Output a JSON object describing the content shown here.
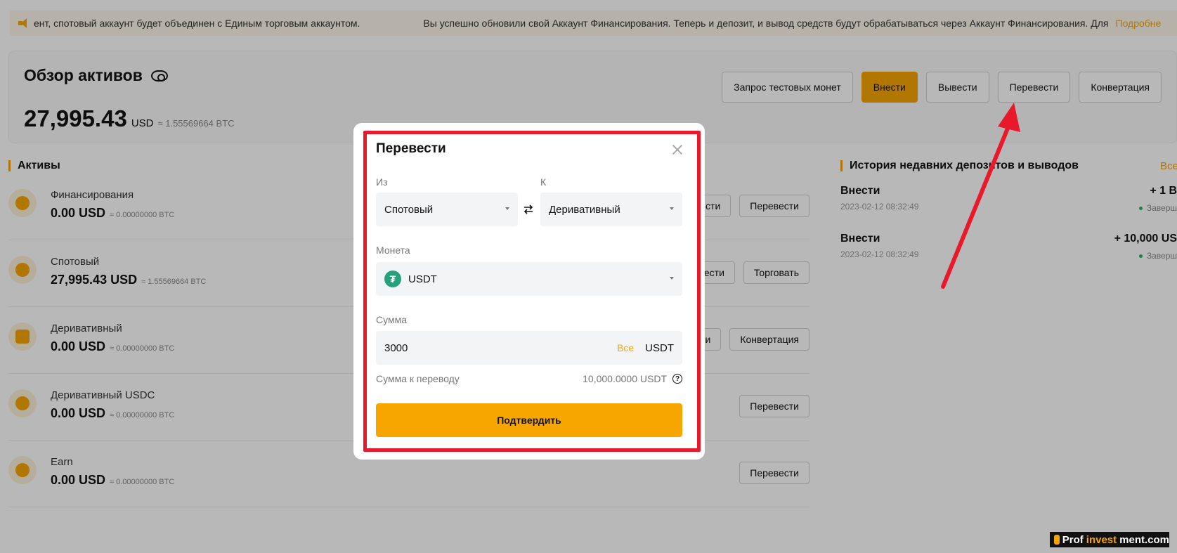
{
  "notice": {
    "text_left": "ент, спотовый аккаунт будет объединен с Единым торговым аккаунтом.",
    "text_main": "Вы успешно обновили свой Аккаунт Финансирования. Теперь и депозит, и вывод средств будут обрабатываться через Аккаунт Финансирования. Для",
    "more": "Подробне"
  },
  "overview": {
    "title": "Обзор активов",
    "amount": "27,995.43",
    "currency": "USD",
    "btc": "≈ 1.55569664 BTC",
    "buttons": {
      "test_coins": "Запрос тестовых монет",
      "deposit": "Внести",
      "withdraw": "Вывести",
      "transfer": "Перевести",
      "convert": "Конвертация"
    }
  },
  "assets": {
    "title": "Активы",
    "rows": [
      {
        "name": "Финансирования",
        "value": "0.00 USD",
        "btc": "≈ 0.00000000 BTC",
        "btn1": "сти",
        "btn2": "Перевести"
      },
      {
        "name": "Спотовый",
        "value": "27,995.43 USD",
        "btc": "≈ 1.55569664 BTC",
        "btn1": "ести",
        "btn2": "Торговать"
      },
      {
        "name": "Деривативный",
        "value": "0.00 USD",
        "btc": "≈ 0.00000000 BTC",
        "btn1": "и",
        "btn2": "Конвертация"
      },
      {
        "name": "Деривативный USDC",
        "value": "0.00 USD",
        "btc": "≈ 0.00000000 BTC",
        "btn2": "Перевести"
      },
      {
        "name": "Earn",
        "value": "0.00 USD",
        "btc": "≈ 0.00000000 BTC",
        "btn2": "Перевести"
      }
    ]
  },
  "history": {
    "title": "История недавних депозитов и выводов",
    "see_all": "Все",
    "items": [
      {
        "type": "Внести",
        "date": "2023-02-12 08:32:49",
        "amount": "+ 1 B",
        "status": "Заверш"
      },
      {
        "type": "Внести",
        "date": "2023-02-12 08:32:49",
        "amount": "+ 10,000 US",
        "status": "Заверш"
      }
    ]
  },
  "modal": {
    "title": "Перевести",
    "from_label": "Из",
    "to_label": "К",
    "from_value": "Спотовый",
    "to_value": "Деривативный",
    "coin_label": "Монета",
    "coin_value": "USDT",
    "coin_symbol": "₮",
    "amount_label": "Сумма",
    "amount_value": "3000",
    "all_label": "Все",
    "amount_unit": "USDT",
    "transfer_label": "Сумма к переводу",
    "transfer_value": "10,000.0000 USDT",
    "confirm": "Подтвердить"
  },
  "watermark": {
    "part1": "Prof",
    "part2": "invest",
    "part3": "ment.com"
  },
  "colors": {
    "accent": "#f7a600",
    "highlight": "#e8192b",
    "coin": "#26a17b"
  }
}
